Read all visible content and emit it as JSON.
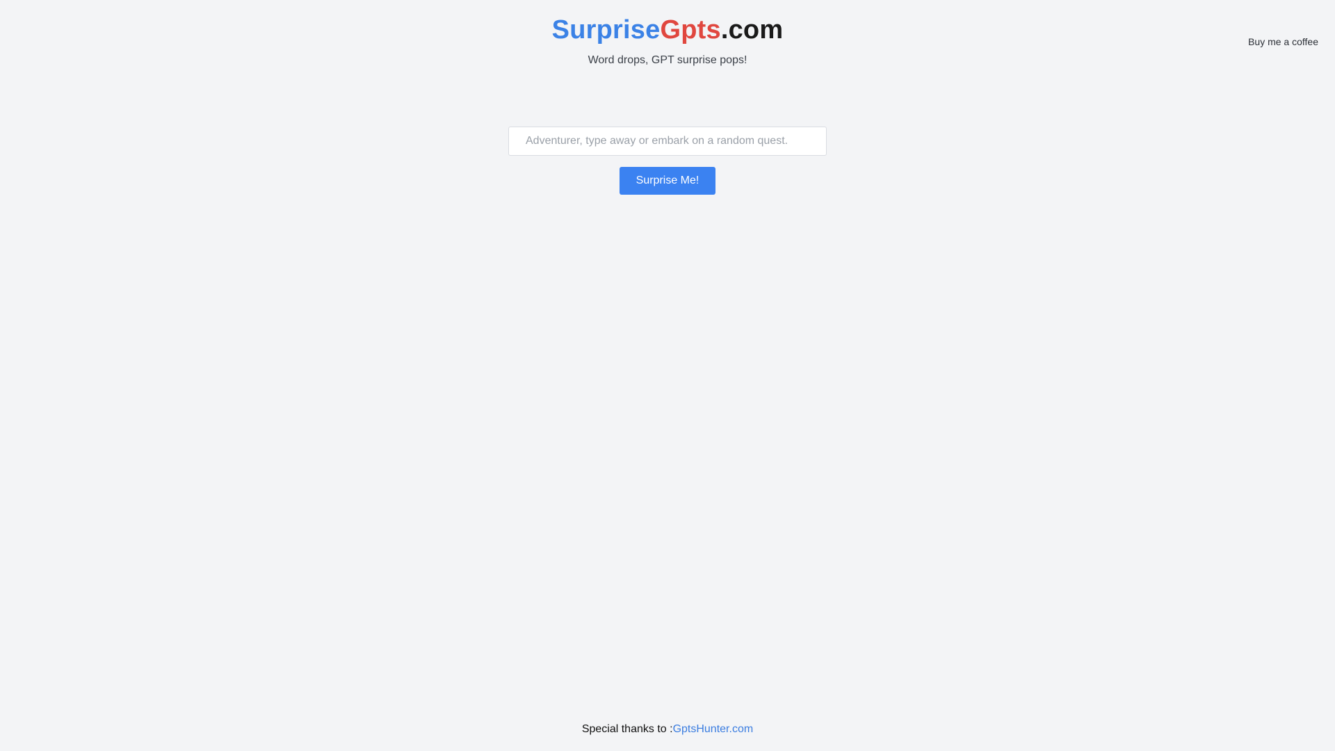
{
  "header": {
    "brand_part_a": "Surprise",
    "brand_part_b": "Gpts",
    "brand_part_c": ".com",
    "tagline": "Word drops, GPT surprise pops!"
  },
  "nav": {
    "coffee_label": "Buy me a coffee"
  },
  "search": {
    "value": "",
    "placeholder": "Adventurer, type away or embark on a random quest."
  },
  "actions": {
    "surprise_label": "Surprise Me!"
  },
  "footer": {
    "thanks_text": "Special thanks to :",
    "thanks_link": "GptsHunter.com"
  },
  "colors": {
    "brand_blue": "#3b82e6",
    "brand_red": "#e0473f",
    "button_blue": "#3b82f1",
    "link_blue": "#3b7de0",
    "background": "#f3f4f6"
  }
}
